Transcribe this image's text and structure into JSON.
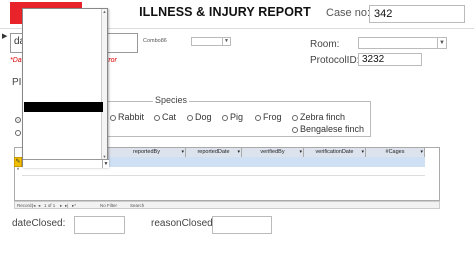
{
  "header": {
    "title": "ILLNESS & INJURY REPORT",
    "case_label": "Case no:",
    "case_value": "342",
    "brand_color": "#e8232a"
  },
  "form": {
    "da_value": "da",
    "combo_label": "Combo86",
    "error_text_left": "*Da",
    "error_text_right": "rror",
    "room_label": "Room:",
    "room_value": "",
    "protocol_label": "ProtocolID:",
    "protocol_value": "3232",
    "pi_label": "PI:",
    "row_marker": "▶"
  },
  "species": {
    "label": "Species",
    "options": [
      "Rabbit",
      "Cat",
      "Dog",
      "Pig",
      "Frog",
      "Zebra finch",
      "Bengalese finch"
    ]
  },
  "grid": {
    "columns": [
      "reportedBy",
      "reportedDate",
      "verifiedBy",
      "verificationDate",
      "#Cages"
    ],
    "edit_marker": "✎",
    "new_marker": "*",
    "nav": {
      "record_label": "Record:",
      "position": "1 of 1",
      "filter_label": "No Filter",
      "search_label": "Search"
    }
  },
  "footer": {
    "date_closed_label": "dateClosed:",
    "reason_closed_label": "reasonClosed:"
  }
}
